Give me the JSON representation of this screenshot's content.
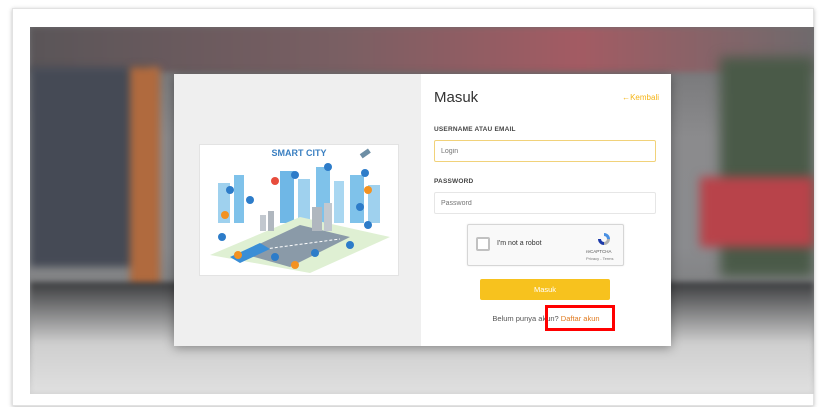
{
  "login": {
    "title": "Masuk",
    "back_label": "←Kembali",
    "username_label": "USERNAME ATAU EMAIL",
    "username_placeholder": "Login",
    "password_label": "PASSWORD",
    "password_placeholder": "Password",
    "submit_label": "Masuk",
    "register_prompt": "Belum punya akun?",
    "register_link": "Daftar akun"
  },
  "captcha": {
    "label": "I'm not a robot",
    "brand": "reCAPTCHA",
    "links": "Privacy - Terms"
  },
  "illustration": {
    "title": "SMART CITY"
  },
  "colors": {
    "accent": "#f7c21e",
    "link": "#e07a1f",
    "highlight": "#ff0000"
  }
}
